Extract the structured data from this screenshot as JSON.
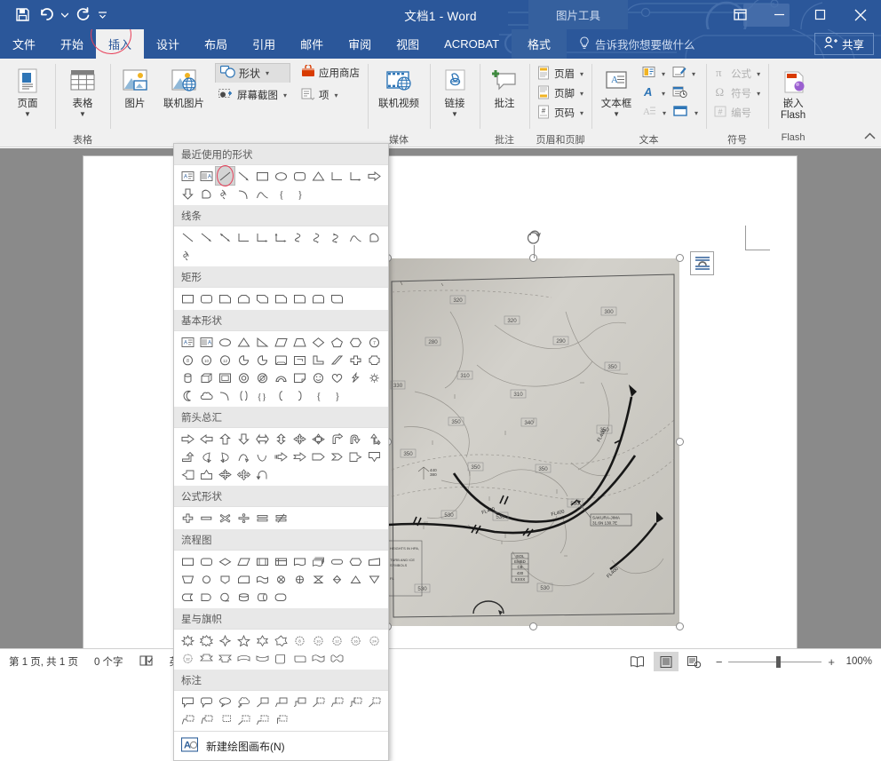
{
  "window": {
    "title": "文档1  -  Word",
    "contextual_tab_group": "图片工具",
    "quick_access": [
      {
        "name": "save",
        "icon": "save-icon"
      },
      {
        "name": "undo",
        "icon": "undo-icon"
      },
      {
        "name": "redo",
        "icon": "redo-icon"
      },
      {
        "name": "customize-qat",
        "icon": "chevron-down-icon"
      }
    ],
    "controls": {
      "ribbon_display": "ribbon-display-options-icon",
      "minimize": "minimize-icon",
      "maximize": "maximize-icon",
      "close": "close-icon"
    }
  },
  "tabs": [
    {
      "label": "文件",
      "active": false
    },
    {
      "label": "开始",
      "active": false
    },
    {
      "label": "插入",
      "active": true,
      "highlighted": true
    },
    {
      "label": "设计",
      "active": false
    },
    {
      "label": "布局",
      "active": false
    },
    {
      "label": "引用",
      "active": false
    },
    {
      "label": "邮件",
      "active": false
    },
    {
      "label": "审阅",
      "active": false
    },
    {
      "label": "视图",
      "active": false
    },
    {
      "label": "ACROBAT",
      "active": false
    },
    {
      "label": "格式",
      "active": false,
      "contextual": true
    }
  ],
  "tell_me": {
    "label": "告诉我你想要做什么",
    "icon": "lightbulb-icon"
  },
  "share": {
    "label": "共享",
    "icon": "share-person-icon"
  },
  "ribbon": {
    "groups": [
      {
        "label": "",
        "items": [
          {
            "label": "页面",
            "icon": "page-icon",
            "has_caret": true,
            "type": "big"
          }
        ]
      },
      {
        "label": "表格",
        "items": [
          {
            "label": "表格",
            "icon": "table-icon",
            "has_caret": true,
            "type": "big"
          }
        ]
      },
      {
        "label": "",
        "items": [
          {
            "label": "图片",
            "icon": "picture-icon",
            "type": "big"
          },
          {
            "label": "联机图片",
            "icon": "online-picture-icon",
            "type": "big"
          }
        ]
      },
      {
        "label": "",
        "items": [
          {
            "label": "形状",
            "icon": "shapes-icon",
            "type": "split",
            "state": "open"
          },
          {
            "label": "屏幕截图",
            "icon": "screenshot-icon",
            "type": "split"
          },
          {
            "label": "应用商店",
            "icon": "store-icon",
            "type": "small"
          },
          {
            "label": "项",
            "icon": "addins-icon",
            "type": "small"
          }
        ]
      },
      {
        "label": "媒体",
        "items": [
          {
            "label": "联机视频",
            "icon": "online-video-icon",
            "type": "big"
          }
        ]
      },
      {
        "label": "",
        "items": [
          {
            "label": "链接",
            "icon": "link-icon",
            "has_caret": true,
            "type": "big"
          }
        ]
      },
      {
        "label": "批注",
        "items": [
          {
            "label": "批注",
            "icon": "comment-icon",
            "type": "big"
          }
        ]
      },
      {
        "label": "页眉和页脚",
        "items": [
          {
            "label": "页眉",
            "icon": "header-icon",
            "type": "small",
            "has_caret": true
          },
          {
            "label": "页脚",
            "icon": "footer-icon",
            "type": "small",
            "has_caret": true
          },
          {
            "label": "页码",
            "icon": "page-number-icon",
            "type": "small",
            "has_caret": true
          }
        ]
      },
      {
        "label": "文本",
        "items": [
          {
            "label": "文本框",
            "icon": "textbox-icon",
            "has_caret": true,
            "type": "big"
          },
          {
            "label": "",
            "icon": "quick-parts-icon",
            "type": "small",
            "has_caret": true
          },
          {
            "label": "",
            "icon": "signature-line-icon",
            "type": "small",
            "has_caret": true
          },
          {
            "label": "",
            "icon": "wordart-icon",
            "type": "small",
            "has_caret": true
          },
          {
            "label": "",
            "icon": "date-time-icon",
            "type": "small"
          },
          {
            "label": "",
            "icon": "drop-cap-icon",
            "type": "small",
            "has_caret": true,
            "disabled": true
          },
          {
            "label": "",
            "icon": "object-icon",
            "type": "small",
            "has_caret": true
          }
        ]
      },
      {
        "label": "符号",
        "items": [
          {
            "label": "公式",
            "icon": "equation-icon",
            "type": "small",
            "has_caret": true,
            "disabled": true
          },
          {
            "label": "符号",
            "icon": "symbol-icon",
            "type": "small",
            "has_caret": true,
            "disabled": true
          },
          {
            "label": "编号",
            "icon": "number-icon",
            "type": "small",
            "disabled": true
          }
        ]
      },
      {
        "label": "Flash",
        "items": [
          {
            "label": "嵌入\nFlash",
            "icon": "flash-icon",
            "type": "big"
          }
        ]
      }
    ],
    "collapse_label": "collapse-ribbon-icon"
  },
  "shapes_menu": {
    "sections": [
      {
        "title": "最近使用的形状",
        "shapes": [
          "text-box",
          "vertical-text-box",
          "line-diagonal-selected",
          "line-arrow",
          "rectangle",
          "oval",
          "rounded-rectangle",
          "triangle",
          "elbow-connector",
          "elbow-arrow-connector",
          "right-arrow",
          "down-arrow",
          "freeform",
          "scribble",
          "arc",
          "curve",
          "left-brace",
          "right-brace"
        ],
        "selected_index": 2
      },
      {
        "title": "线条",
        "shapes": [
          "line",
          "line-arrow",
          "line-double-arrow",
          "elbow-connector",
          "elbow-arrow-connector",
          "elbow-double-arrow-connector",
          "curved-connector",
          "curved-arrow-connector",
          "curved-double-arrow-connector",
          "curve",
          "freeform",
          "scribble"
        ]
      },
      {
        "title": "矩形",
        "shapes": [
          "rectangle",
          "rounded-rectangle",
          "snip-single-corner-rectangle",
          "snip-same-side-corner-rectangle",
          "snip-diagonal-corner-rectangle",
          "snip-and-round-single-corner-rectangle",
          "round-single-corner-rectangle",
          "round-same-side-corner-rectangle",
          "round-diagonal-corner-rectangle"
        ]
      },
      {
        "title": "基本形状",
        "shapes": [
          "text-box",
          "vertical-text-box",
          "oval",
          "isosceles-triangle",
          "right-triangle",
          "parallelogram",
          "trapezoid",
          "diamond",
          "pentagon",
          "hexagon",
          "heptagon",
          "octagon",
          "decagon",
          "dodecagon",
          "pie",
          "teardrop",
          "frame",
          "half-frame",
          "l-shape",
          "diagonal-stripe",
          "cross",
          "plaque",
          "can",
          "cube",
          "bevel",
          "donut",
          "no-symbol",
          "block-arc",
          "folded-corner",
          "smiley-face",
          "heart",
          "lightning-bolt",
          "sun",
          "moon",
          "cloud",
          "arc",
          "double-bracket",
          "double-brace",
          "left-bracket",
          "right-bracket",
          "left-brace",
          "right-brace"
        ]
      },
      {
        "title": "箭头总汇",
        "shapes": [
          "right-arrow",
          "left-arrow",
          "up-arrow",
          "down-arrow",
          "left-right-arrow",
          "up-down-arrow",
          "four-way-arrow",
          "quad-arrow-callout",
          "bent-arrow",
          "u-turn-arrow",
          "left-up-arrow",
          "bent-up-arrow",
          "curved-left-arrow",
          "curved-right-arrow",
          "curved-up-arrow",
          "curved-down-arrow",
          "striped-right-arrow",
          "notched-right-arrow",
          "pentagon-arrow",
          "chevron",
          "right-arrow-callout",
          "down-arrow-callout",
          "left-arrow-callout",
          "up-arrow-callout",
          "left-right-arrow-callout",
          "quad-arrow",
          "circular-arrow"
        ]
      },
      {
        "title": "公式形状",
        "shapes": [
          "plus",
          "minus",
          "multiply",
          "division",
          "equal",
          "not-equal"
        ]
      },
      {
        "title": "流程图",
        "shapes": [
          "flowchart-process",
          "flowchart-alternate-process",
          "flowchart-decision",
          "flowchart-data",
          "flowchart-predefined-process",
          "flowchart-internal-storage",
          "flowchart-document",
          "flowchart-multidocument",
          "flowchart-terminator",
          "flowchart-preparation",
          "flowchart-manual-input",
          "flowchart-manual-operation",
          "flowchart-connector",
          "flowchart-off-page-connector",
          "flowchart-card",
          "flowchart-punched-tape",
          "flowchart-summing-junction",
          "flowchart-or",
          "flowchart-collate",
          "flowchart-sort",
          "flowchart-extract",
          "flowchart-merge",
          "flowchart-stored-data",
          "flowchart-delay",
          "flowchart-sequential-access-storage",
          "flowchart-magnetic-disk",
          "flowchart-direct-access-storage",
          "flowchart-display"
        ]
      },
      {
        "title": "星与旗帜",
        "shapes": [
          "explosion-1",
          "explosion-2",
          "star-4-point",
          "star-5-point",
          "star-6-point",
          "star-7-point",
          "star-8-point",
          "star-10-point",
          "star-12-point",
          "star-16-point",
          "star-24-point",
          "star-32-point",
          "up-ribbon",
          "down-ribbon",
          "curved-up-ribbon",
          "curved-down-ribbon",
          "vertical-scroll",
          "horizontal-scroll",
          "wave",
          "double-wave"
        ]
      },
      {
        "title": "标注",
        "shapes": [
          "rectangular-callout",
          "rounded-rectangular-callout",
          "oval-callout",
          "cloud-callout",
          "line-callout-1",
          "line-callout-2",
          "line-callout-3",
          "line-callout-1-accent-bar",
          "line-callout-2-accent-bar",
          "line-callout-3-accent-bar",
          "line-callout-1-border-accent",
          "line-callout-2-border-accent",
          "line-callout-3-border-accent",
          "line-callout-no-border-1",
          "line-callout-no-border-2",
          "line-callout-no-border-3"
        ]
      }
    ],
    "footer": {
      "label": "新建绘图画布(N)",
      "icon": "drawing-canvas-icon"
    }
  },
  "document": {
    "selected_object": {
      "type": "picture",
      "description": "扫描的航空高空天气图",
      "layout_options_icon": "layout-options-icon",
      "rotate_handle_icon": "rotate-icon",
      "map_labels": [
        "320",
        "320",
        "280",
        "310",
        "310",
        "330",
        "330",
        "350",
        "350",
        "300",
        "290",
        "340",
        "350",
        "350",
        "340",
        "530",
        "530",
        "530",
        "530",
        "440/380",
        "FL400",
        "FL400",
        "FL400",
        "FL400"
      ],
      "map_annotation": "SAKURA-JIMA 31.6N 130.7E"
    }
  },
  "status_bar": {
    "page_info": "第 1 页, 共 1 页",
    "word_count": "0 个字",
    "proofing_icon": "proofing-errors-icon",
    "language": "英语(美国)",
    "views": [
      {
        "name": "read-mode",
        "icon": "read-mode-icon",
        "active": false
      },
      {
        "name": "print-layout",
        "icon": "print-layout-icon",
        "active": true
      },
      {
        "name": "web-layout",
        "icon": "web-layout-icon",
        "active": false
      }
    ],
    "zoom_out": "−",
    "zoom_in": "+",
    "zoom_level": "100%"
  },
  "colors": {
    "titlebar": "#2b579a",
    "contextual_tab": "#35609e",
    "ribbon_bg": "#f0f0f0",
    "accent_highlight": "#e8425b",
    "workspace": "#8a8a8a",
    "page": "#ffffff"
  }
}
